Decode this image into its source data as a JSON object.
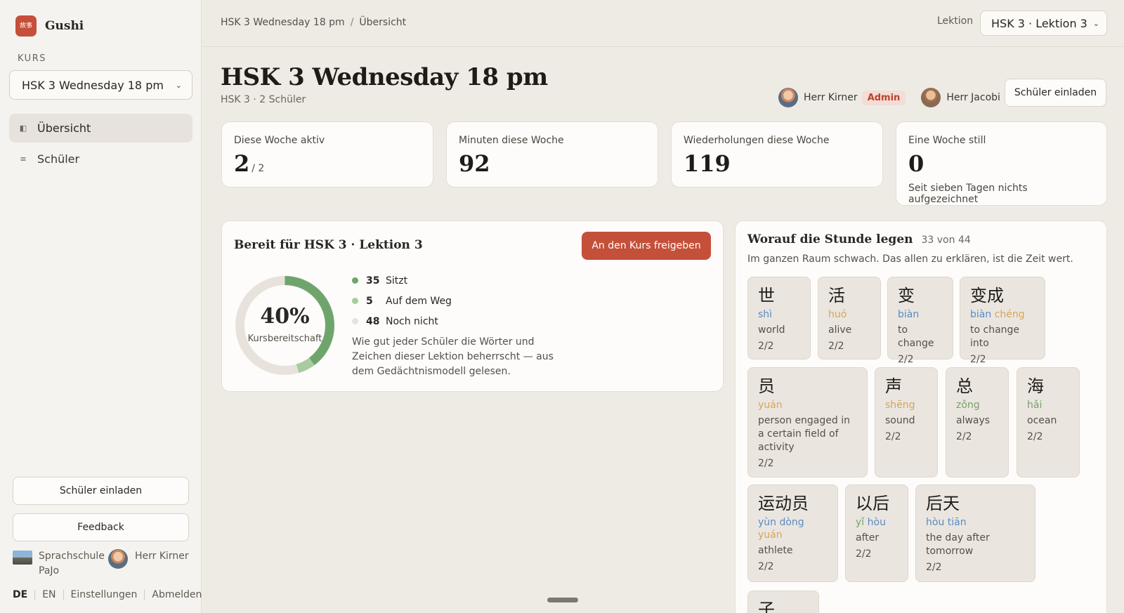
{
  "brand": {
    "logo_text": "故事",
    "name": "Gushi"
  },
  "sidebar": {
    "section_label": "KURS",
    "course_value": "HSK 3 Wednesday 18 pm",
    "nav": [
      {
        "label": "Übersicht",
        "icon": "panel-icon"
      },
      {
        "label": "Schüler",
        "icon": "list-icon"
      }
    ],
    "invite_button": "Schüler einladen",
    "feedback_button": "Feedback",
    "school_name": "Sprachschule PaJo",
    "user_name": "Herr Kirner",
    "lang_de": "DE",
    "lang_en": "EN",
    "settings": "Einstellungen",
    "logout": "Abmelden"
  },
  "topbar": {
    "breadcrumb_course": "HSK 3 Wednesday 18 pm",
    "breadcrumb_sep": "/",
    "breadcrumb_page": "Übersicht",
    "lektion_label": "Lektion",
    "lektion_value": "HSK 3 · Lektion 3"
  },
  "header": {
    "title": "HSK 3 Wednesday 18 pm",
    "subtitle": "HSK 3 · 2 Schüler",
    "teacher1": "Herr Kirner",
    "admin_badge": "Admin",
    "teacher2": "Herr Jacobi",
    "invite_button": "Schüler einladen"
  },
  "stats": [
    {
      "label": "Diese Woche aktiv",
      "value": "2",
      "suffix": "/ 2"
    },
    {
      "label": "Minuten diese Woche",
      "value": "92"
    },
    {
      "label": "Wiederholungen diese Woche",
      "value": "119"
    },
    {
      "label": "Eine Woche still",
      "value": "0",
      "note": "Seit sieben Tagen nichts aufgezeichnet"
    }
  ],
  "readiness": {
    "title": "Bereit für HSK 3 · Lektion 3",
    "share_button": "An den Kurs freigeben",
    "percent_label": "40%",
    "caption": "Kursbereitschaft",
    "legend": [
      {
        "count": "35",
        "label": "Sitzt",
        "color": "#6fa56c"
      },
      {
        "count": "5",
        "label": "Auf dem Weg",
        "color": "#a9cb9f"
      },
      {
        "count": "48",
        "label": "Noch nicht",
        "color": "#e7e3dc"
      }
    ],
    "description": "Wie gut jeder Schüler die Wörter und Zeichen dieser Lektion beherrscht — aus dem Gedächtnismodell gelesen.",
    "chart_data": {
      "type": "pie",
      "categories": [
        "Sitzt",
        "Auf dem Weg",
        "Noch nicht"
      ],
      "values": [
        35,
        5,
        48
      ]
    }
  },
  "focus": {
    "title": "Worauf die Stunde legen",
    "count": "33 von 44",
    "description": "Im ganzen Raum schwach. Das allen zu erklären, ist die Zeit wert.",
    "words": [
      {
        "hanzi": "世",
        "pinyin": [
          {
            "t": "shì",
            "tone": 3
          }
        ],
        "meaning": "world",
        "score": "2/2"
      },
      {
        "hanzi": "活",
        "pinyin": [
          {
            "t": "huó",
            "tone": 1
          }
        ],
        "meaning": "alive",
        "score": "2/2"
      },
      {
        "hanzi": "变",
        "pinyin": [
          {
            "t": "biàn",
            "tone": 3
          }
        ],
        "meaning": "to change",
        "score": "2/2"
      },
      {
        "hanzi": "变成",
        "pinyin": [
          {
            "t": "biàn",
            "tone": 3
          },
          {
            "t": "chéng",
            "tone": 1
          }
        ],
        "meaning": "to change into",
        "score": "2/2"
      },
      {
        "hanzi": "员",
        "pinyin": [
          {
            "t": "yuán",
            "tone": 1
          }
        ],
        "meaning": "person engaged in a certain field of activity",
        "score": "2/2"
      },
      {
        "hanzi": "声",
        "pinyin": [
          {
            "t": "shēng",
            "tone": 1
          }
        ],
        "meaning": "sound",
        "score": "2/2"
      },
      {
        "hanzi": "总",
        "pinyin": [
          {
            "t": "zǒng",
            "tone": 2
          }
        ],
        "meaning": "always",
        "score": "2/2"
      },
      {
        "hanzi": "海",
        "pinyin": [
          {
            "t": "hǎi",
            "tone": 2
          }
        ],
        "meaning": "ocean",
        "score": "2/2"
      },
      {
        "hanzi": "运动员",
        "pinyin": [
          {
            "t": "yùn",
            "tone": 3
          },
          {
            "t": "dòng",
            "tone": 3
          },
          {
            "t": "yuán",
            "tone": 1
          }
        ],
        "meaning": "athlete",
        "score": "2/2"
      },
      {
        "hanzi": "以后",
        "pinyin": [
          {
            "t": "yǐ",
            "tone": 2
          },
          {
            "t": "hòu",
            "tone": 3
          }
        ],
        "meaning": "after",
        "score": "2/2"
      },
      {
        "hanzi": "后天",
        "pinyin": [
          {
            "t": "hòu",
            "tone": 3
          },
          {
            "t": "tiān",
            "tone": 3
          }
        ],
        "meaning": "the day after tomorrow",
        "score": "2/2"
      },
      {
        "hanzi": "子"
      }
    ]
  }
}
